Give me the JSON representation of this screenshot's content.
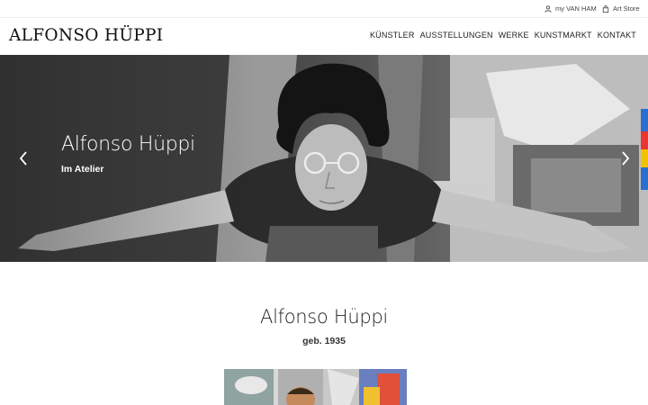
{
  "utility": {
    "my_account_label": "my VAN HAM",
    "store_label": "Art Store"
  },
  "header": {
    "logo": "ALFONSO HÜPPI",
    "nav": [
      "KÜNSTLER",
      "AUSSTELLUNGEN",
      "WERKE",
      "KUNSTMARKT",
      "KONTAKT"
    ]
  },
  "hero": {
    "title": "Alfonso Hüppi",
    "subtitle": "Im Atelier"
  },
  "artist": {
    "name": "Alfonso Hüppi",
    "born": "geb. 1935"
  },
  "icons": {
    "account": "user-icon",
    "store": "shopping-bag-icon",
    "prev": "chevron-left-icon",
    "next": "chevron-right-icon"
  }
}
